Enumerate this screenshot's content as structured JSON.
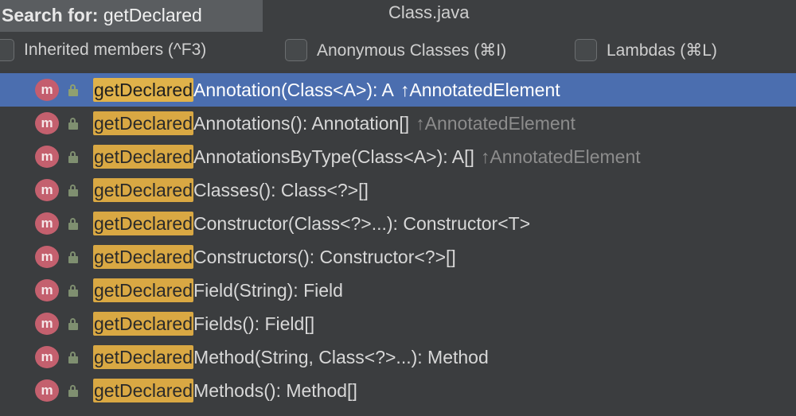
{
  "search": {
    "prefix": "Search for: ",
    "query": "getDeclared"
  },
  "window": {
    "title": "Class.java"
  },
  "options": [
    {
      "label": "Inherited members (^F3)",
      "checked": false
    },
    {
      "label": "Anonymous Classes (⌘I)",
      "checked": false
    },
    {
      "label": "Lambdas (⌘L)",
      "checked": false
    }
  ],
  "icons": {
    "method_badge": "m",
    "method_badge_color": "#c4606e",
    "match_highlight_color": "#d9a843",
    "selection_color": "#4b6eaf"
  },
  "results": [
    {
      "match": "getDeclared",
      "rest": "Annotation(Class<A>): A",
      "owner": "↑AnnotatedElement",
      "selected": true
    },
    {
      "match": "getDeclared",
      "rest": "Annotations(): Annotation[]",
      "owner": "↑AnnotatedElement",
      "selected": false
    },
    {
      "match": "getDeclared",
      "rest": "AnnotationsByType(Class<A>): A[]",
      "owner": "↑AnnotatedElement",
      "selected": false
    },
    {
      "match": "getDeclared",
      "rest": "Classes(): Class<?>[]",
      "owner": "",
      "selected": false
    },
    {
      "match": "getDeclared",
      "rest": "Constructor(Class<?>...): Constructor<T>",
      "owner": "",
      "selected": false
    },
    {
      "match": "getDeclared",
      "rest": "Constructors(): Constructor<?>[]",
      "owner": "",
      "selected": false
    },
    {
      "match": "getDeclared",
      "rest": "Field(String): Field",
      "owner": "",
      "selected": false
    },
    {
      "match": "getDeclared",
      "rest": "Fields(): Field[]",
      "owner": "",
      "selected": false
    },
    {
      "match": "getDeclared",
      "rest": "Method(String, Class<?>...): Method",
      "owner": "",
      "selected": false
    },
    {
      "match": "getDeclared",
      "rest": "Methods(): Method[]",
      "owner": "",
      "selected": false
    }
  ]
}
